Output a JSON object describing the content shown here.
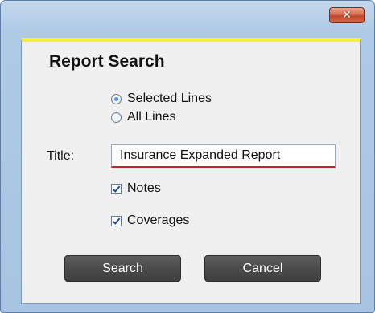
{
  "window": {
    "close_glyph": "✕"
  },
  "dialog": {
    "heading": "Report Search",
    "scope": {
      "options": [
        {
          "label": "Selected Lines",
          "selected": true
        },
        {
          "label": "All Lines",
          "selected": false
        }
      ]
    },
    "title_field": {
      "label": "Title:",
      "value": "Insurance Expanded Report"
    },
    "options": [
      {
        "label": "Notes",
        "checked": true
      },
      {
        "label": "Coverages",
        "checked": true
      }
    ],
    "buttons": {
      "search_label": "Search",
      "cancel_label": "Cancel"
    }
  },
  "colors": {
    "accent_stripe": "#f5ee3b",
    "close_red": "#c3462a",
    "button_dark": "#4b4b4b",
    "input_underline": "#d22222"
  }
}
